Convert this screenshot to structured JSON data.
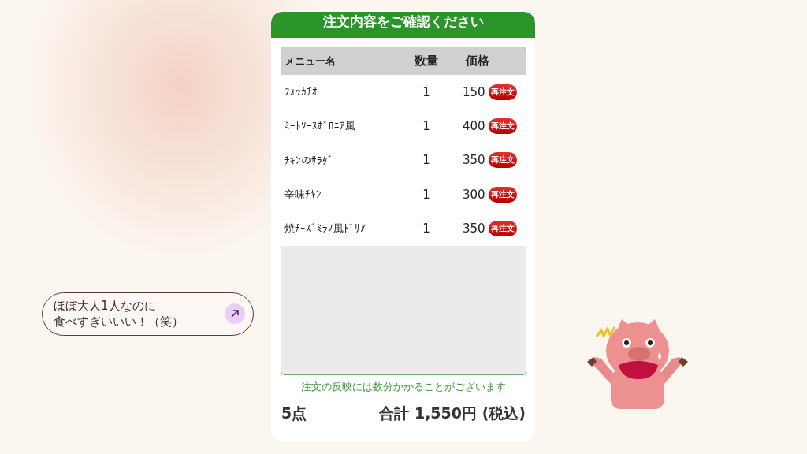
{
  "order_screen": {
    "title": "注文内容をご確認ください",
    "table": {
      "columns": [
        "メニュー名",
        "数量",
        "価格"
      ],
      "rows": [
        {
          "name": "ﾌｫｯｶﾁｵ",
          "quantity": "1",
          "price": "150",
          "button": "再注文"
        },
        {
          "name": "ﾐｰﾄｿｰｽﾎﾞﾛﾆｱ風",
          "quantity": "1",
          "price": "400",
          "button": "再注文"
        },
        {
          "name": "ﾁｷﾝのｻﾗﾀﾞ",
          "quantity": "1",
          "price": "350",
          "button": "再注文"
        },
        {
          "name": "辛味ﾁｷﾝ",
          "quantity": "1",
          "price": "300",
          "button": "再注文"
        },
        {
          "name": "焼ﾁｰｽﾞﾐﾗﾉ風ﾄﾞﾘｱ",
          "quantity": "1",
          "price": "350",
          "button": "再注文"
        }
      ]
    },
    "notice": "注文の反映には数分かかることがございます",
    "count": "5点",
    "total": "合計 1,550円 (税込)"
  },
  "comment": {
    "lines": [
      "ほぼ大人1人なのに",
      "食べすぎいいい！（笑）"
    ]
  }
}
